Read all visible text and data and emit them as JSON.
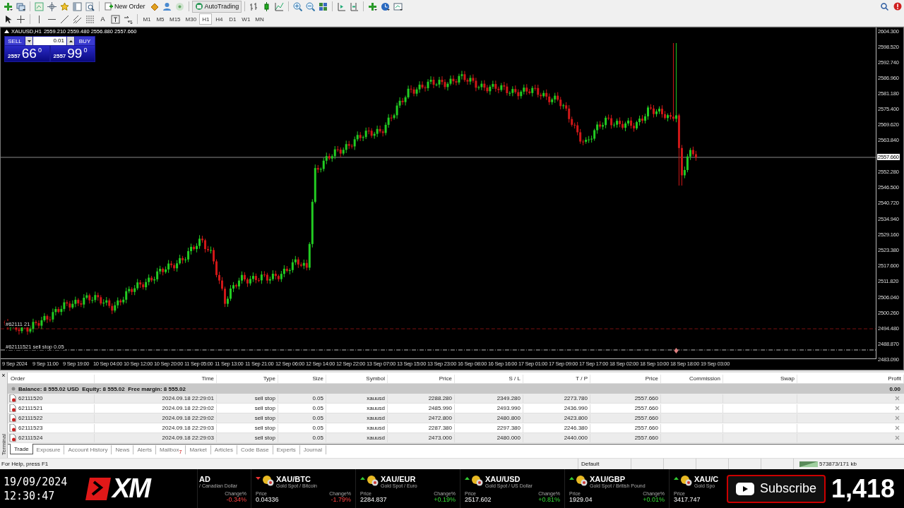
{
  "toolbar": {
    "new_order": "New Order",
    "auto_trading": "AutoTrading",
    "text_tool": "A",
    "timeframes": [
      {
        "label": "M1",
        "selected": false
      },
      {
        "label": "M5",
        "selected": false
      },
      {
        "label": "M15",
        "selected": false
      },
      {
        "label": "M30",
        "selected": false
      },
      {
        "label": "H1",
        "selected": true
      },
      {
        "label": "H4",
        "selected": false
      },
      {
        "label": "D1",
        "selected": false
      },
      {
        "label": "W1",
        "selected": false
      },
      {
        "label": "MN",
        "selected": false
      }
    ]
  },
  "chart": {
    "title": "XAUUSD,H1",
    "ohlc": "2559.210 2559.480 2556.880 2557.660",
    "one_click": {
      "sell": "SELL",
      "buy": "BUY",
      "lot": "0.01",
      "bid_big": "2557",
      "bid_pips": "66",
      "bid_point": "0",
      "ask_big": "2557",
      "ask_pips": "99",
      "ask_point": "0"
    },
    "order_labels": [
      "#62111 21",
      "#62111521 sell stop 0.05"
    ],
    "price_axis": [
      "2604.300",
      "2598.520",
      "2592.740",
      "2586.960",
      "2581.180",
      "2575.400",
      "2569.620",
      "2563.840",
      "2552.280",
      "2546.500",
      "2540.720",
      "2534.940",
      "2529.160",
      "2523.380",
      "2517.600",
      "2511.820",
      "2506.040",
      "2500.260",
      "2494.480",
      "2488.870",
      "2483.090"
    ],
    "current_price": "2557.660",
    "time_axis": [
      "9 Sep 2024",
      "9 Sep 11:00",
      "9 Sep 19:00",
      "10 Sep 04:00",
      "10 Sep 12:00",
      "10 Sep 20:00",
      "11 Sep 05:00",
      "11 Sep 13:00",
      "11 Sep 21:00",
      "12 Sep 06:00",
      "12 Sep 14:00",
      "12 Sep 22:00",
      "13 Sep 07:00",
      "13 Sep 15:00",
      "13 Sep 23:00",
      "16 Sep 08:00",
      "16 Sep 16:00",
      "17 Sep 01:00",
      "17 Sep 09:00",
      "17 Sep 17:00",
      "18 Sep 02:00",
      "18 Sep 10:00",
      "18 Sep 18:00",
      "19 Sep 03:00"
    ]
  },
  "terminal": {
    "side_label": "Terminal",
    "close": "×",
    "columns": [
      "Order",
      "Time",
      "Type",
      "Size",
      "Symbol",
      "Price",
      "S / L",
      "T / P",
      "Price",
      "Commission",
      "Swap",
      "Profit"
    ],
    "balance": "Balance: 8 555.02 USD  Equity: 8 555.02  Free margin: 8 555.02",
    "total_profit": "0.00",
    "rows": [
      {
        "order": "62111520",
        "time": "2024.09.18 22:29:01",
        "type": "sell stop",
        "size": "0.05",
        "symbol": "xauusd",
        "price": "2288.280",
        "sl": "2349.280",
        "tp": "2273.780",
        "current": "2557.660"
      },
      {
        "order": "62111521",
        "time": "2024.09.18 22:29:02",
        "type": "sell stop",
        "size": "0.05",
        "symbol": "xauusd",
        "price": "2485.990",
        "sl": "2493.990",
        "tp": "2436.990",
        "current": "2557.660"
      },
      {
        "order": "62111522",
        "time": "2024.09.18 22:29:02",
        "type": "sell stop",
        "size": "0.05",
        "symbol": "xauusd",
        "price": "2472.800",
        "sl": "2480.800",
        "tp": "2423.800",
        "current": "2557.660"
      },
      {
        "order": "62111523",
        "time": "2024.09.18 22:29:03",
        "type": "sell stop",
        "size": "0.05",
        "symbol": "xauusd",
        "price": "2287.380",
        "sl": "2297.380",
        "tp": "2246.380",
        "current": "2557.660"
      },
      {
        "order": "62111524",
        "time": "2024.09.18 22:29:03",
        "type": "sell stop",
        "size": "0.05",
        "symbol": "xauusd",
        "price": "2473.000",
        "sl": "2480.000",
        "tp": "2440.000",
        "current": "2557.660"
      }
    ],
    "tabs": [
      {
        "label": "Trade",
        "selected": true
      },
      {
        "label": "Exposure",
        "selected": false
      },
      {
        "label": "Account History",
        "selected": false
      },
      {
        "label": "News",
        "selected": false
      },
      {
        "label": "Alerts",
        "selected": false
      },
      {
        "label": "Mailbox",
        "selected": false,
        "badge": "7"
      },
      {
        "label": "Market",
        "selected": false
      },
      {
        "label": "Articles",
        "selected": false
      },
      {
        "label": "Code Base",
        "selected": false
      },
      {
        "label": "Experts",
        "selected": false
      },
      {
        "label": "Journal",
        "selected": false
      }
    ]
  },
  "status_bar": {
    "help": "For Help, press F1",
    "profile": "Default",
    "traffic": "573873/171 kb"
  },
  "stream": {
    "date": "19/09/2024",
    "time": "12:30:47",
    "logo": "XM",
    "subscribe": "Subscribe",
    "count": "1,418",
    "ticker": [
      {
        "kind": "partial",
        "symbol": "AD",
        "name": "/ Canadian Dollar",
        "change_label": "Change%",
        "change": "-0.34%",
        "rising": false
      },
      {
        "kind": "full",
        "symbol": "XAU/BTC",
        "name": "Gold Spot / Bitcoin",
        "price_label": "Price",
        "price": "0.04336",
        "change_label": "Change%",
        "change": "-1.79%",
        "rising": false
      },
      {
        "kind": "full",
        "symbol": "XAU/EUR",
        "name": "Gold Spot / Euro",
        "price_label": "Price",
        "price": "2284.837",
        "change_label": "Change%",
        "change": "+0.19%",
        "rising": true
      },
      {
        "kind": "full",
        "symbol": "XAU/USD",
        "name": "Gold Spot / US Dollar",
        "price_label": "Price",
        "price": "2517.602",
        "change_label": "Change%",
        "change": "+0.81%",
        "rising": true
      },
      {
        "kind": "full",
        "symbol": "XAU/GBP",
        "name": "Gold Spot / British Pound",
        "price_label": "Price",
        "price": "1929.04",
        "change_label": "Change%",
        "change": "+0.01%",
        "rising": true
      },
      {
        "kind": "full",
        "symbol": "XAU/C",
        "name": "Gold Spo",
        "price_label": "Price",
        "price": "3417.747",
        "rising": true
      }
    ]
  }
}
